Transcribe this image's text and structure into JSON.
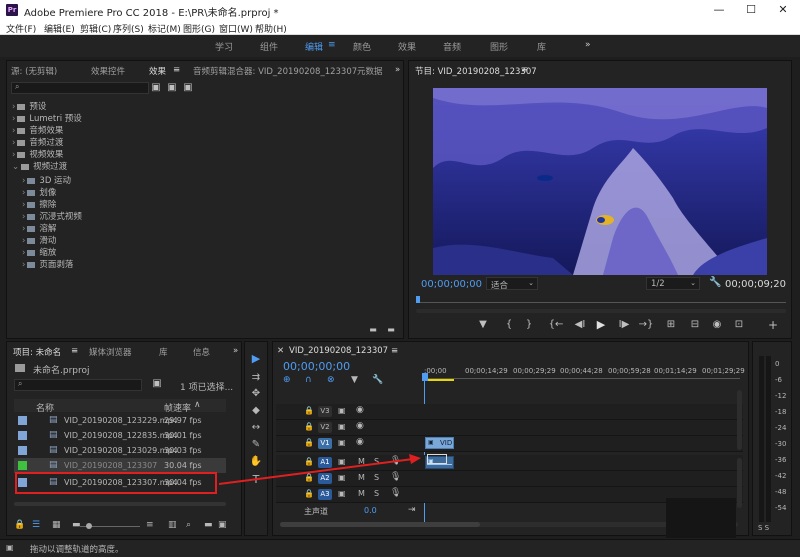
{
  "titlebar": {
    "app_icon": "Pr",
    "title": "Adobe Premiere Pro CC 2018 - E:\\PR\\未命名.prproj *",
    "minimize": "—",
    "maximize": "☐",
    "close": "✕"
  },
  "menu": [
    "文件(F)",
    "编辑(E)",
    "剪辑(C)",
    "序列(S)",
    "标记(M)",
    "图形(G)",
    "窗口(W)",
    "帮助(H)"
  ],
  "workspaces": {
    "items": [
      "学习",
      "组件",
      "编辑",
      "颜色",
      "效果",
      "音频",
      "图形",
      "库"
    ],
    "active_menu": "≡",
    "more": "»"
  },
  "effects_panel": {
    "tabs": [
      "源: (无剪辑)",
      "效果控件",
      "效果",
      "≡",
      "音频剪辑混合器: VID_20190208_123307",
      "元数据",
      "»"
    ],
    "tree": [
      "预设",
      "Lumetri 预设",
      "音频效果",
      "音频过渡",
      "视频效果",
      "视频过渡"
    ],
    "sub_tree": [
      "3D 运动",
      "划像",
      "擦除",
      "沉浸式视频",
      "溶解",
      "滑动",
      "缩放",
      "页面剥落"
    ]
  },
  "program_monitor": {
    "tab": "节目: VID_20190208_123307",
    "menu_icon": "≡",
    "timecode_left": "00;00;00;00",
    "fit": "适合",
    "resolution": "1/2",
    "timecode_right": "00;00;09;20",
    "buttons": [
      "▼",
      "{",
      "}",
      "{←",
      "◀I",
      "▶",
      "I▶",
      "→}",
      "⊞",
      "⊟",
      "◉",
      "⊡",
      "+"
    ]
  },
  "project_panel": {
    "tabs": [
      "项目: 未命名",
      "≡",
      "媒体浏览器",
      "库",
      "信息",
      "»"
    ],
    "project_file": "未命名.prproj",
    "selection": "1 项已选择...",
    "col_name": "名称",
    "col_rate": "帧速率",
    "sort_icon": "∧",
    "items": [
      {
        "name": "VID_20190208_123229.mp4",
        "rate": "29.97 fps",
        "color": "#7fa6d6"
      },
      {
        "name": "VID_20190208_122835.mp4",
        "rate": "30.01 fps",
        "color": "#7fa6d6"
      },
      {
        "name": "VID_20190208_123029.mp4",
        "rate": "30.03 fps",
        "color": "#7fa6d6"
      },
      {
        "name": "VID_20190208_123307",
        "rate": "30.04 fps",
        "color": "#3fc03f"
      },
      {
        "name": "VID_20190208_123307.mp4",
        "rate": "30.04 fps",
        "color": "#7fa6d6"
      }
    ]
  },
  "tools": [
    "▶",
    "⇉",
    "✥",
    "◆",
    "↔",
    "✎",
    "✋",
    "T"
  ],
  "timeline": {
    "tab": "VID_20190208_123307",
    "close": "✕",
    "menu_icon": "≡",
    "timecode": "00;00;00;00",
    "ruler": [
      ":00;00",
      "00;00;14;29",
      "00;00;29;29",
      "00;00;44;28",
      "00;00;59;28",
      "00;01;14;29",
      "00;01;29;29"
    ],
    "video_tracks": [
      "V3",
      "V2",
      "V1"
    ],
    "audio_tracks": [
      "A1",
      "A2",
      "A3"
    ],
    "mute": "M",
    "solo": "S",
    "master": "主声道",
    "master_value": "0.0",
    "clip_label": "VID"
  },
  "meter_scale": [
    "0",
    "-6",
    "-12",
    "-18",
    "-24",
    "-30",
    "-36",
    "-42",
    "-48",
    "-54"
  ],
  "meter_footer": "S S",
  "status": "拖动以调整轨道的高度。",
  "annotation_color": "#e02020"
}
